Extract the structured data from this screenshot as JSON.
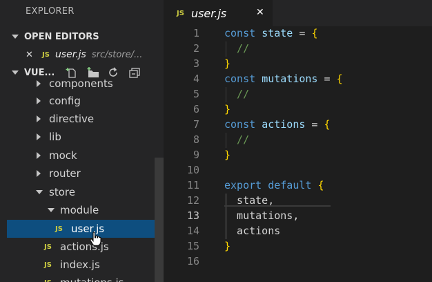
{
  "explorer": {
    "title": "EXPLORER",
    "open_editors": {
      "label": "OPEN EDITORS",
      "items": [
        {
          "close": "✕",
          "icon": "JS",
          "name": "user.js",
          "path": "src/store/..."
        }
      ]
    },
    "project": {
      "label": "VUE...",
      "toolbar_icons": [
        "new-file-icon",
        "new-folder-icon",
        "refresh-icon",
        "collapse-all-icon"
      ]
    },
    "tree": [
      {
        "label": "components",
        "type": "folder"
      },
      {
        "label": "config",
        "type": "folder"
      },
      {
        "label": "directive",
        "type": "folder"
      },
      {
        "label": "lib",
        "type": "folder"
      },
      {
        "label": "mock",
        "type": "folder"
      },
      {
        "label": "router",
        "type": "folder"
      },
      {
        "label": "store",
        "type": "folder-open"
      },
      {
        "label": "module",
        "type": "folder-open"
      },
      {
        "label": "user.js",
        "type": "file",
        "icon": "JS",
        "selected": true
      },
      {
        "label": "actions.js",
        "type": "file",
        "icon": "JS"
      },
      {
        "label": "index.js",
        "type": "file",
        "icon": "JS"
      },
      {
        "label": "mutations.js",
        "type": "file",
        "icon": "JS"
      }
    ]
  },
  "tab": {
    "icon": "JS",
    "name": "user.js",
    "close": "✕"
  },
  "editor": {
    "active_line": 13,
    "lines": [
      {
        "n": "1",
        "tokens": [
          [
            "kw",
            "const "
          ],
          [
            "vr",
            "state"
          ],
          [
            "op",
            " = "
          ],
          [
            "br",
            "{"
          ]
        ]
      },
      {
        "n": "2",
        "tokens": [
          [
            "cm",
            "  //"
          ]
        ]
      },
      {
        "n": "3",
        "tokens": [
          [
            "br",
            "}"
          ]
        ]
      },
      {
        "n": "4",
        "tokens": [
          [
            "kw",
            "const "
          ],
          [
            "vr",
            "mutations"
          ],
          [
            "op",
            " = "
          ],
          [
            "br",
            "{"
          ]
        ]
      },
      {
        "n": "5",
        "tokens": [
          [
            "cm",
            "  //"
          ]
        ]
      },
      {
        "n": "6",
        "tokens": [
          [
            "br",
            "}"
          ]
        ]
      },
      {
        "n": "7",
        "tokens": [
          [
            "kw",
            "const "
          ],
          [
            "vr",
            "actions"
          ],
          [
            "op",
            " = "
          ],
          [
            "br",
            "{"
          ]
        ]
      },
      {
        "n": "8",
        "tokens": [
          [
            "cm",
            "  //"
          ]
        ]
      },
      {
        "n": "9",
        "tokens": [
          [
            "br",
            "}"
          ]
        ]
      },
      {
        "n": "10",
        "tokens": []
      },
      {
        "n": "11",
        "tokens": [
          [
            "kw",
            "export default "
          ],
          [
            "br",
            "{"
          ]
        ]
      },
      {
        "n": "12",
        "tokens": [
          [
            "pr",
            "  state,"
          ]
        ]
      },
      {
        "n": "13",
        "tokens": [
          [
            "pr",
            "  mutations,"
          ]
        ]
      },
      {
        "n": "14",
        "tokens": [
          [
            "pr",
            "  actions"
          ]
        ]
      },
      {
        "n": "15",
        "tokens": [
          [
            "br",
            "}"
          ]
        ]
      },
      {
        "n": "16",
        "tokens": []
      }
    ]
  }
}
